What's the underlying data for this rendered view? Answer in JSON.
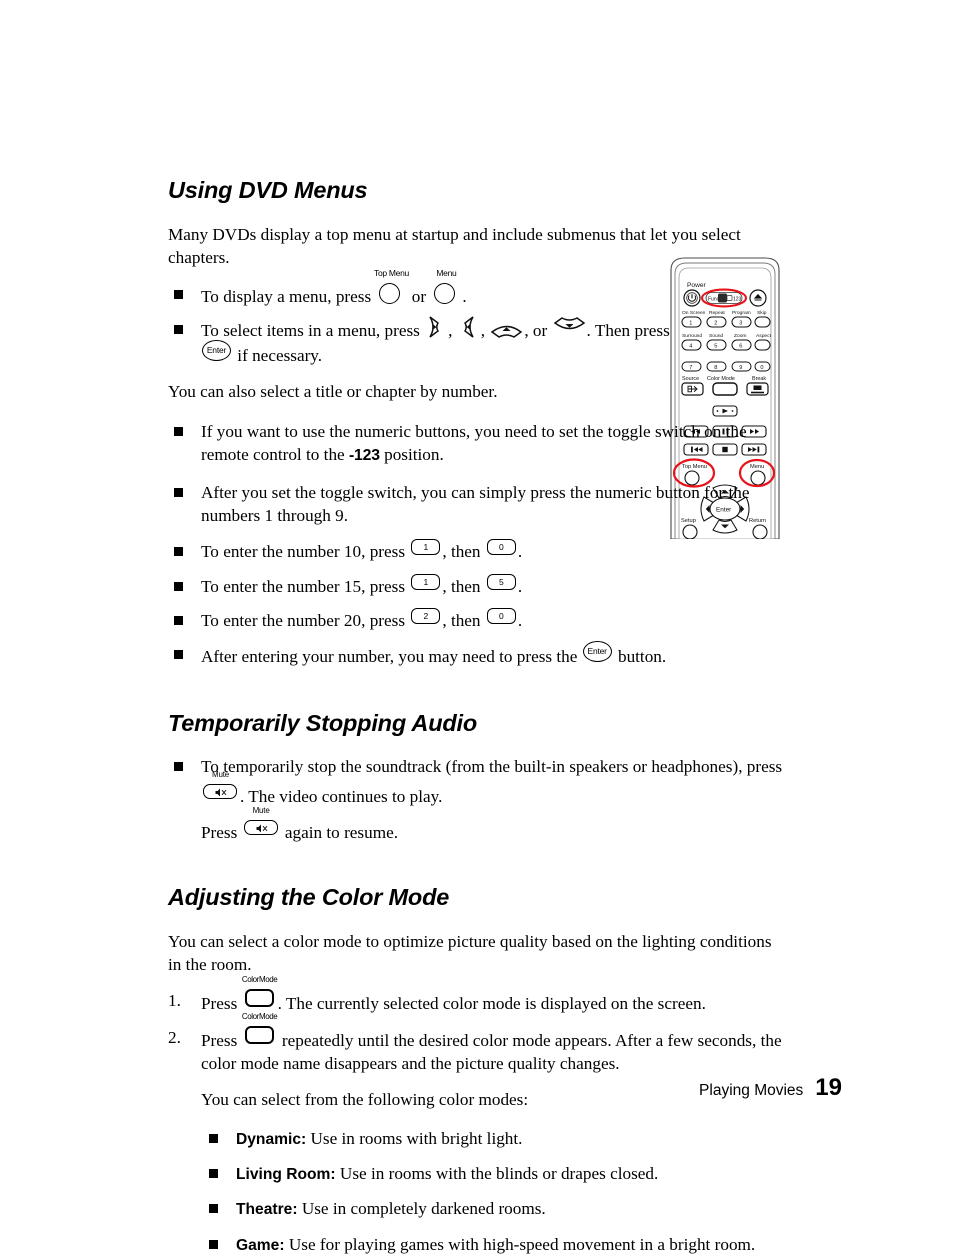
{
  "page": {
    "footer_section": "Playing Movies",
    "footer_page_number": "19"
  },
  "sections": [
    {
      "title": "Using DVD Menus",
      "intro": "Many DVDs display a top menu at startup and include submenus that let you select chapters.",
      "bullets_1": [
        {
          "pre": "To display a menu, press ",
          "mid": " or ",
          "post": "."
        },
        {
          "pre": "To select items in a menu, press ",
          "mid": ", ",
          "post": ". Then press ",
          "tail": " if necessary."
        }
      ],
      "mid_para": "You can also select a title or chapter by number.",
      "bullets_2": [
        {
          "text_a": "If you want to use the numeric buttons, you need to set the toggle switch on the remote control to the ",
          "toggle_label": "-123",
          "text_b": " position."
        },
        {
          "text_a": "After you set the toggle switch, you can simply press the numeric button for the numbers 1 through 9."
        },
        {
          "text_a": "To enter the number 10, press ",
          "key1": "1",
          "text_b": ", then ",
          "key2": "0",
          "text_c": "."
        },
        {
          "text_a": "To enter the number 15, press ",
          "key1": "1",
          "text_b": ", then ",
          "key2": "5",
          "text_c": "."
        },
        {
          "text_a": "To enter the number 20, press ",
          "key1": "2",
          "text_b": ", then ",
          "key2": "0",
          "text_c": "."
        },
        {
          "text_a": "After entering your number, you may need to press the ",
          "text_b": " button."
        }
      ]
    },
    {
      "title": "Temporarily Stopping Audio",
      "bullet": {
        "line1_a": "To temporarily stop the soundtrack (from the built-in speakers or headphones), press ",
        "line1_b": ". The video continues to play.",
        "line2_a": "Press ",
        "line2_b": " again to resume."
      }
    },
    {
      "title": "Adjusting the Color Mode",
      "intro": "You can select a color mode to optimize picture quality based on the lighting conditions in the room.",
      "steps": [
        {
          "num": "1.",
          "text_a": "Press ",
          "text_b": ". The currently selected color mode is displayed on the screen."
        },
        {
          "num": "2.",
          "text_a": "Press ",
          "text_b": " repeatedly until the desired color mode appears. After a few seconds, the color mode name disappears and the picture quality changes."
        }
      ],
      "modes_intro": "You can select from the following color modes:",
      "modes": [
        {
          "name": "Dynamic:",
          "desc": " Use in rooms with bright light."
        },
        {
          "name": "Living Room:",
          "desc": " Use in rooms with the blinds or drapes closed."
        },
        {
          "name": "Theatre:",
          "desc": " Use in completely darkened rooms."
        },
        {
          "name": "Game:",
          "desc": " Use for playing games with high-speed movement in a bright room."
        }
      ]
    }
  ],
  "glyph_labels": {
    "top_menu": "Top Menu",
    "menu": "Menu",
    "enter": "Enter",
    "mute": "Mute",
    "color_mode": "ColorMode"
  },
  "remote": {
    "power_label": "Power",
    "toggle_left": "Func",
    "toggle_right": "123",
    "row_labels_1": [
      "On Screen",
      "Repeat",
      "Program",
      "Skip"
    ],
    "row_keys_1": [
      "1",
      "2",
      "3",
      ""
    ],
    "row_labels_2": [
      "Surround",
      "Sound",
      "Zoom",
      "Aspect"
    ],
    "row_keys_2": [
      "4",
      "5",
      "6",
      ""
    ],
    "row_keys_3": [
      "7",
      "8",
      "9",
      "0"
    ],
    "row_labels_3": [
      "Source",
      "Color Mode",
      "Break"
    ],
    "nav_labels": {
      "top_menu": "Top Menu",
      "menu": "Menu",
      "enter": "Enter",
      "setup": "Setup",
      "return": "Return"
    },
    "highlight_color": "#e8121a"
  }
}
